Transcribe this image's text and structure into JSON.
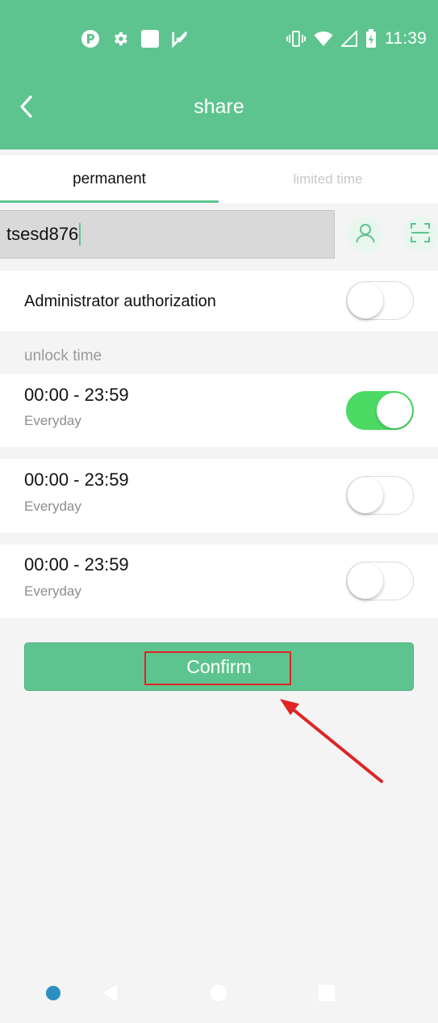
{
  "status_bar": {
    "time": "11:39",
    "left_icons": [
      "app-logo-icon",
      "settings-icon",
      "square-notification-icon",
      "checkmark-app-icon"
    ],
    "right_icons": [
      "vibrate-icon",
      "wifi-icon",
      "cellular-signal-icon",
      "battery-charging-icon"
    ]
  },
  "header": {
    "title": "share",
    "back_icon": "chevron-left-icon",
    "background_color": "#5ec48f"
  },
  "tabs": [
    {
      "label": "permanent",
      "active": true
    },
    {
      "label": "limited time",
      "active": false
    }
  ],
  "account_input": {
    "value": "tsesd876",
    "contact_icon": "person-icon",
    "scan_icon": "scan-icon"
  },
  "admin_authorization": {
    "label": "Administrator authorization",
    "enabled": false
  },
  "unlock_section": {
    "label": "unlock time",
    "slots": [
      {
        "time": "00:00 - 23:59",
        "repeat": "Everyday",
        "enabled": true
      },
      {
        "time": "00:00 - 23:59",
        "repeat": "Everyday",
        "enabled": false
      },
      {
        "time": "00:00 - 23:59",
        "repeat": "Everyday",
        "enabled": false
      }
    ]
  },
  "confirm_button": {
    "label": "Confirm",
    "color": "#5ec48f"
  },
  "annotation": {
    "highlight_color": "#e02424"
  },
  "nav_bar": {
    "items": [
      "assistant-dot-icon",
      "back-triangle-icon",
      "home-circle-icon",
      "recents-square-icon"
    ]
  }
}
